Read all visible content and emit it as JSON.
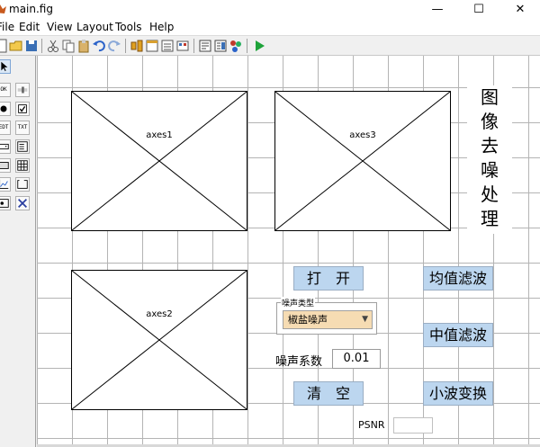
{
  "window": {
    "title": "main.fig",
    "minimize": "—",
    "maximize": "☐",
    "close": "✕"
  },
  "menu": {
    "items": [
      "File",
      "Edit",
      "View",
      "Layout",
      "Tools",
      "Help"
    ]
  },
  "palette": {
    "labels": [
      "OK",
      "TXT",
      "TXT",
      "EDT",
      "TBL",
      "ACT"
    ]
  },
  "canvas": {
    "axes": [
      "axes1",
      "axes3",
      "axes2"
    ],
    "title_chars": [
      "图",
      "像",
      "去",
      "噪",
      "处",
      "理"
    ],
    "buttons": {
      "open": "打　开",
      "clear": "清　空",
      "mean": "均值滤波",
      "median": "中值滤波",
      "wavelet": "小波变换"
    },
    "noise_group": {
      "title": "噪声类型",
      "selected": "椒盐噪声"
    },
    "noise_coef": {
      "label": "噪声系数",
      "value": "0.01"
    },
    "psnr": {
      "label": "PSNR",
      "value": ""
    }
  }
}
